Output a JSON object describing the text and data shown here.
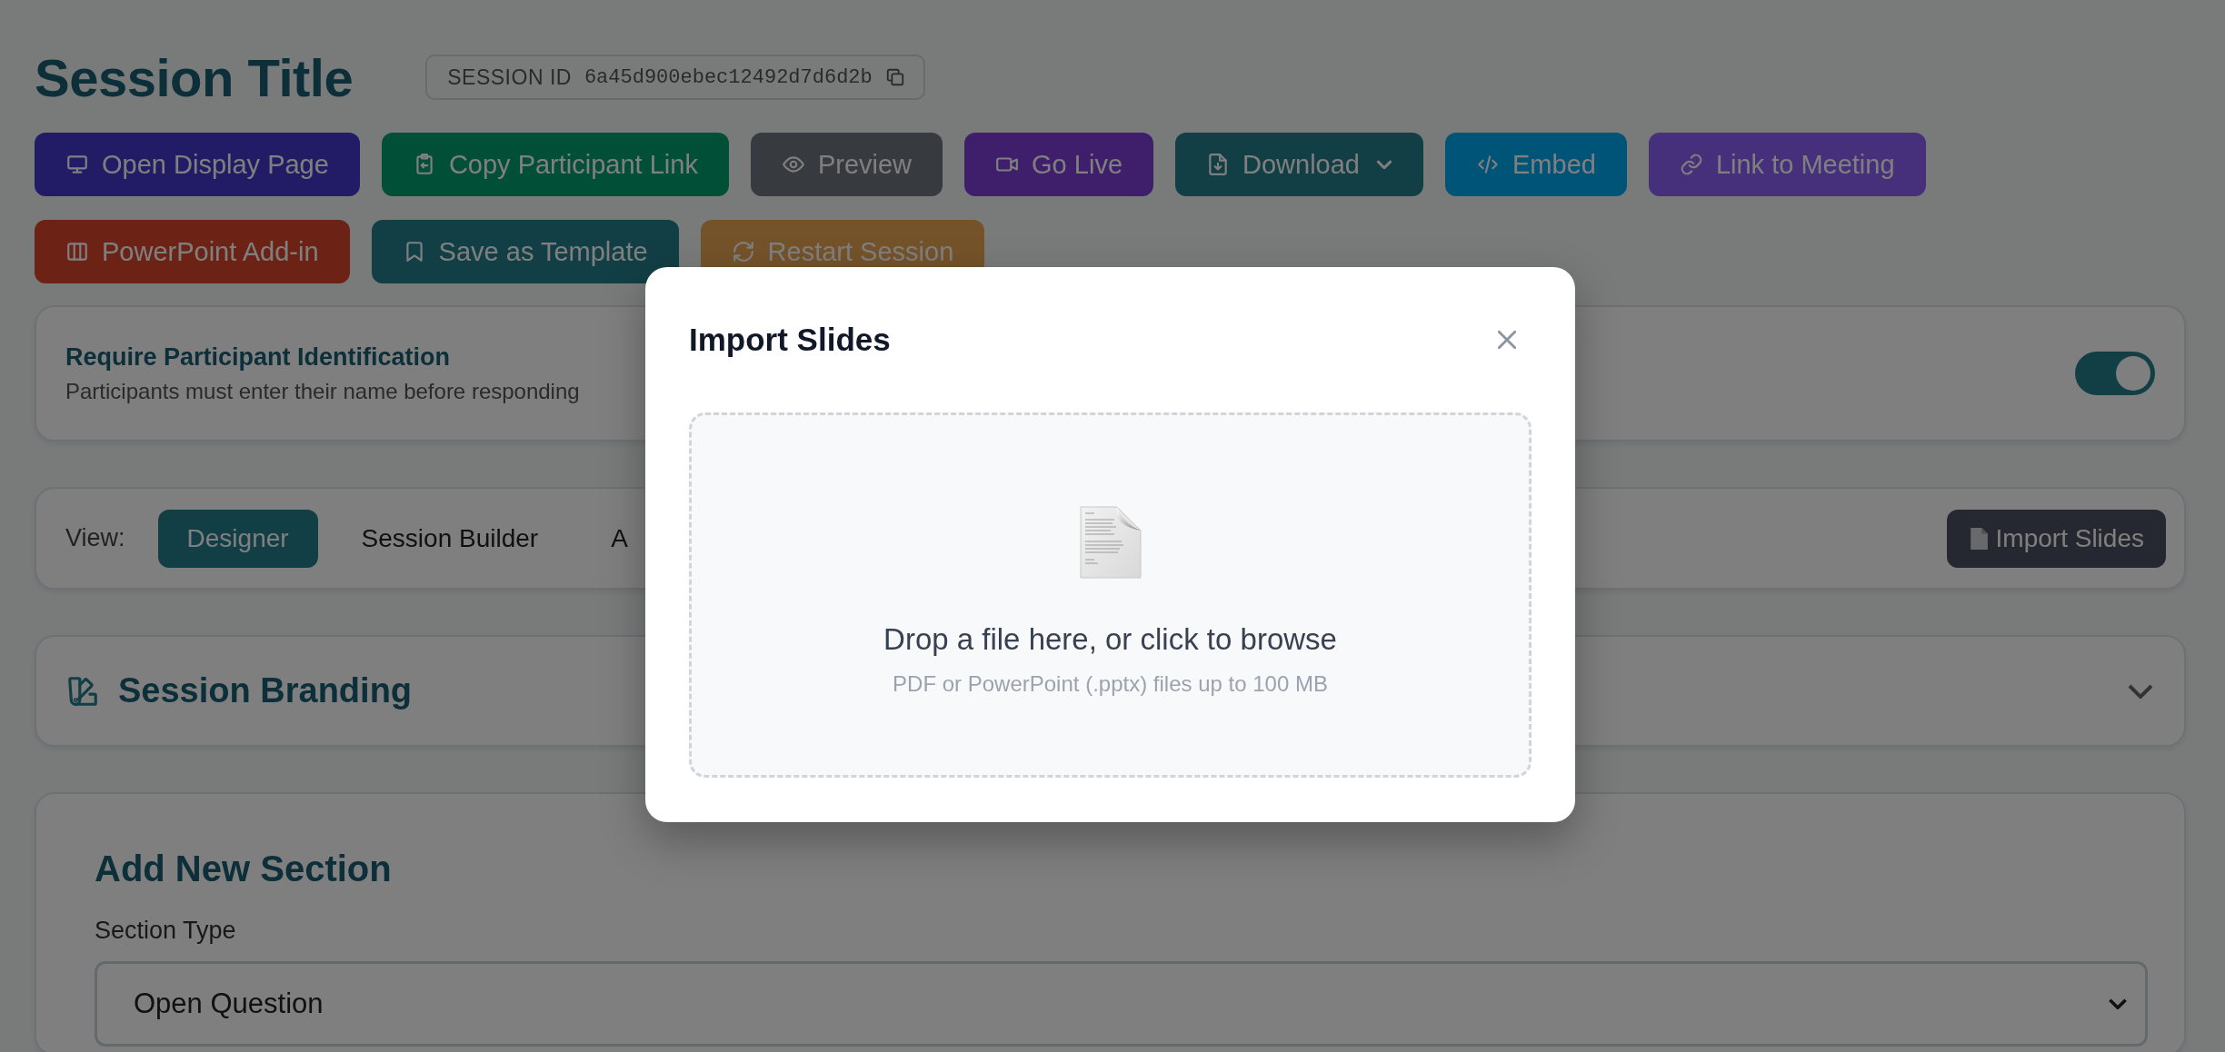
{
  "header": {
    "title": "Session Title",
    "session_id_label": "SESSION ID",
    "session_id": "6a45d900ebec12492d7d6d2b"
  },
  "action_buttons": [
    {
      "label": "Open Display Page",
      "dropdown": false
    },
    {
      "label": "Copy Participant Link",
      "dropdown": false
    },
    {
      "label": "Preview",
      "dropdown": false
    },
    {
      "label": "Go Live",
      "dropdown": false
    },
    {
      "label": "Download",
      "dropdown": true
    },
    {
      "label": "Embed",
      "dropdown": false
    },
    {
      "label": "Link to Meeting",
      "dropdown": false
    },
    {
      "label": "PowerPoint Add-in",
      "dropdown": false
    },
    {
      "label": "Save as Template",
      "dropdown": false
    },
    {
      "label": "Restart Session",
      "dropdown": false
    }
  ],
  "identification": {
    "title": "Require Participant Identification",
    "description": "Participants must enter their name before responding",
    "on": true
  },
  "view_bar": {
    "label": "View:",
    "tabs": [
      {
        "label": "Designer",
        "selected": true
      },
      {
        "label": "Session Builder",
        "selected": false
      },
      {
        "label": "A",
        "selected": false
      }
    ],
    "import_button": "Import Slides"
  },
  "branding": {
    "title": "Session Branding",
    "expanded": false
  },
  "add_section": {
    "title": "Add New Section",
    "field_label": "Section Type",
    "value": "Open Question"
  },
  "modal": {
    "title": "Import Slides",
    "drop_text": "Drop a file here, or click to browse",
    "drop_hint": "PDF or PowerPoint (.pptx) files up to 100 MB"
  }
}
